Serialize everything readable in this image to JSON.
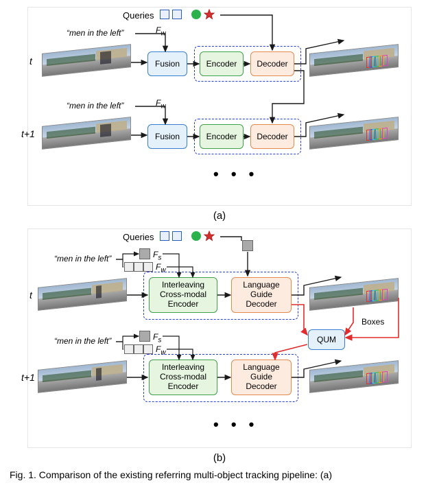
{
  "queries_label": "Queries",
  "text_prompt": "“men in the left”",
  "fw_label": "F",
  "fw_sub": "w",
  "fs_label": "F",
  "fs_sub": "s",
  "t_label": "t",
  "t1_label": "t+1",
  "blocks": {
    "fusion": "Fusion",
    "encoder": "Encoder",
    "decoder": "Decoder",
    "ice": "Interleaving Cross-modal Encoder",
    "lgd": "Language Guide Decoder",
    "qum": "QUM",
    "boxes": "Boxes"
  },
  "ellipsis": "• • •",
  "sub_a": "(a)",
  "sub_b": "(b)",
  "caption": "Fig. 1.  Comparison of the existing referring multi-object tracking pipeline: (a)"
}
